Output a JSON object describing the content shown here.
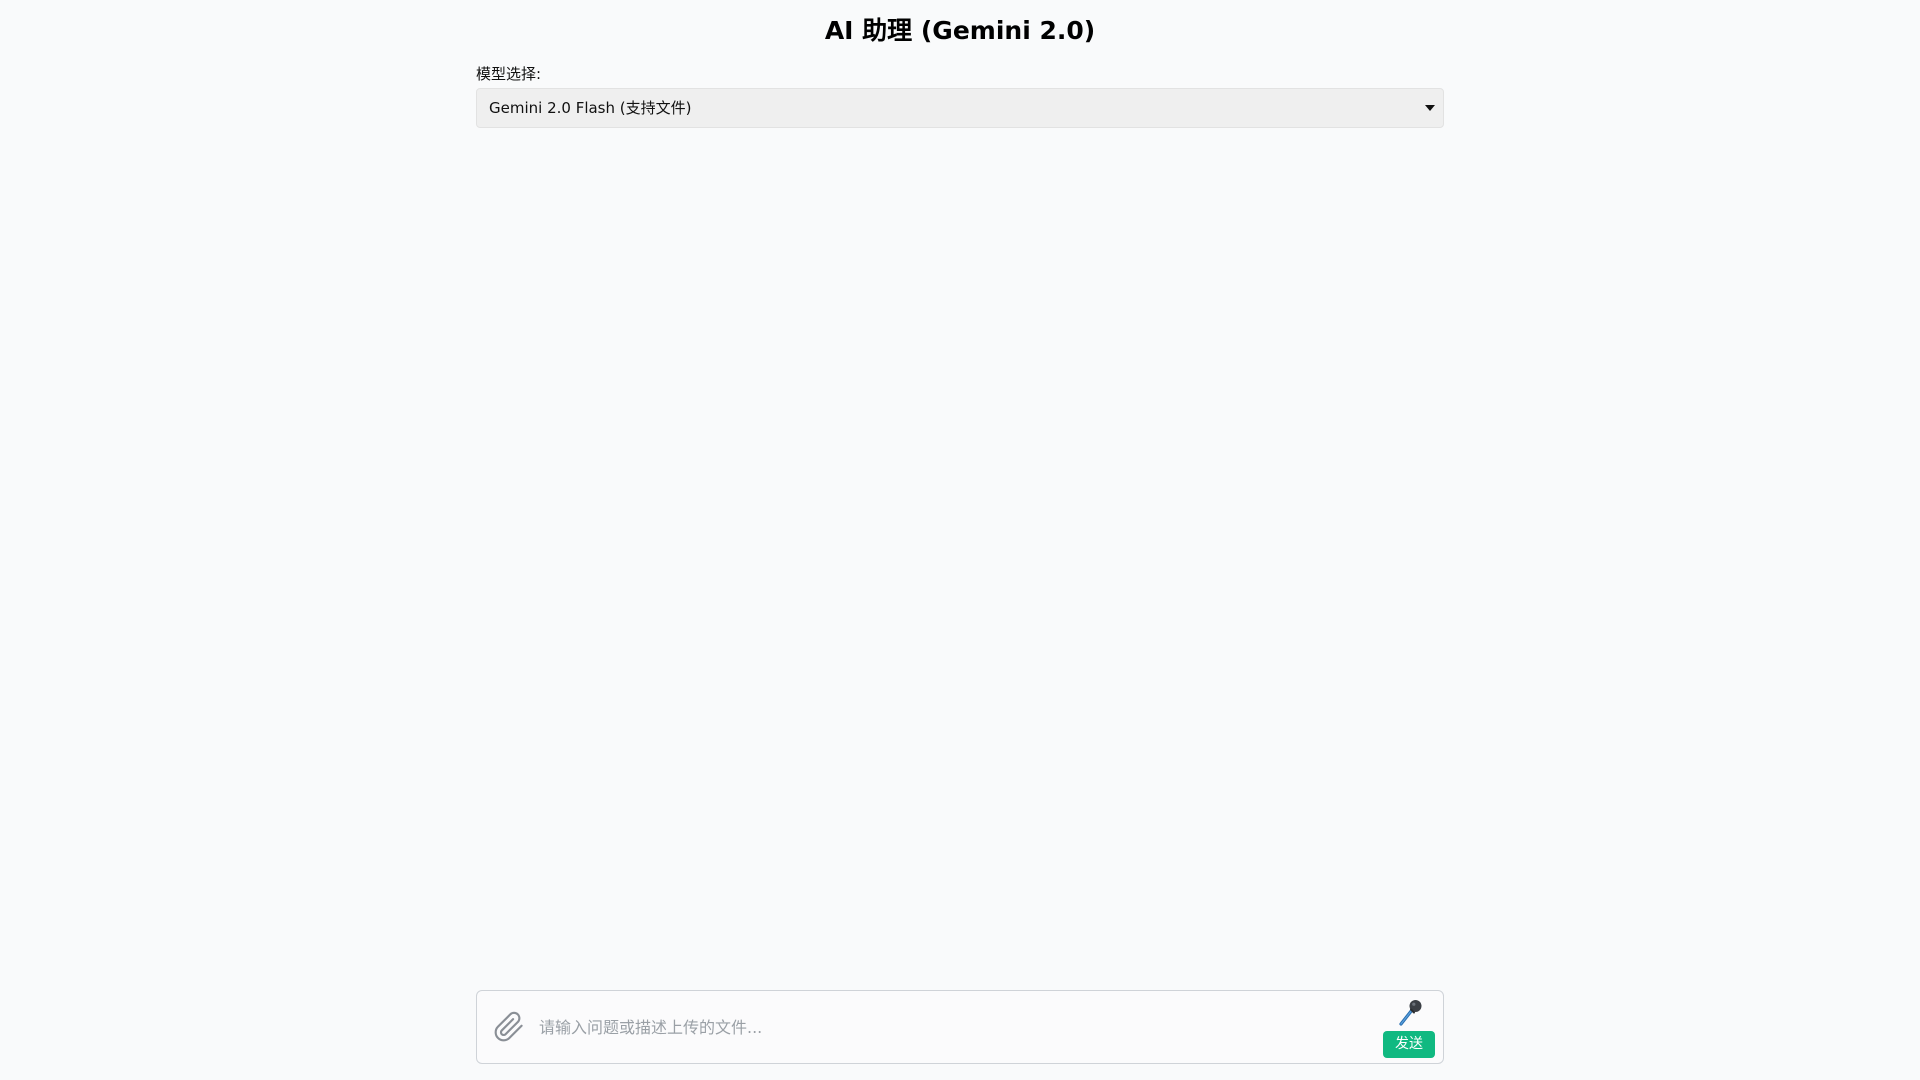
{
  "header": {
    "title": "AI 助理 (Gemini 2.0)"
  },
  "model": {
    "label": "模型选择:",
    "selected": "Gemini 2.0 Flash (支持文件)"
  },
  "composer": {
    "placeholder": "请输入问题或描述上传的文件...",
    "value": "",
    "send_label": "发送",
    "attach_icon": "paperclip-icon",
    "mic_icon": "microphone-icon"
  },
  "colors": {
    "background": "#f9fafb",
    "select_background": "#efefef",
    "send_button": "#10b981"
  }
}
